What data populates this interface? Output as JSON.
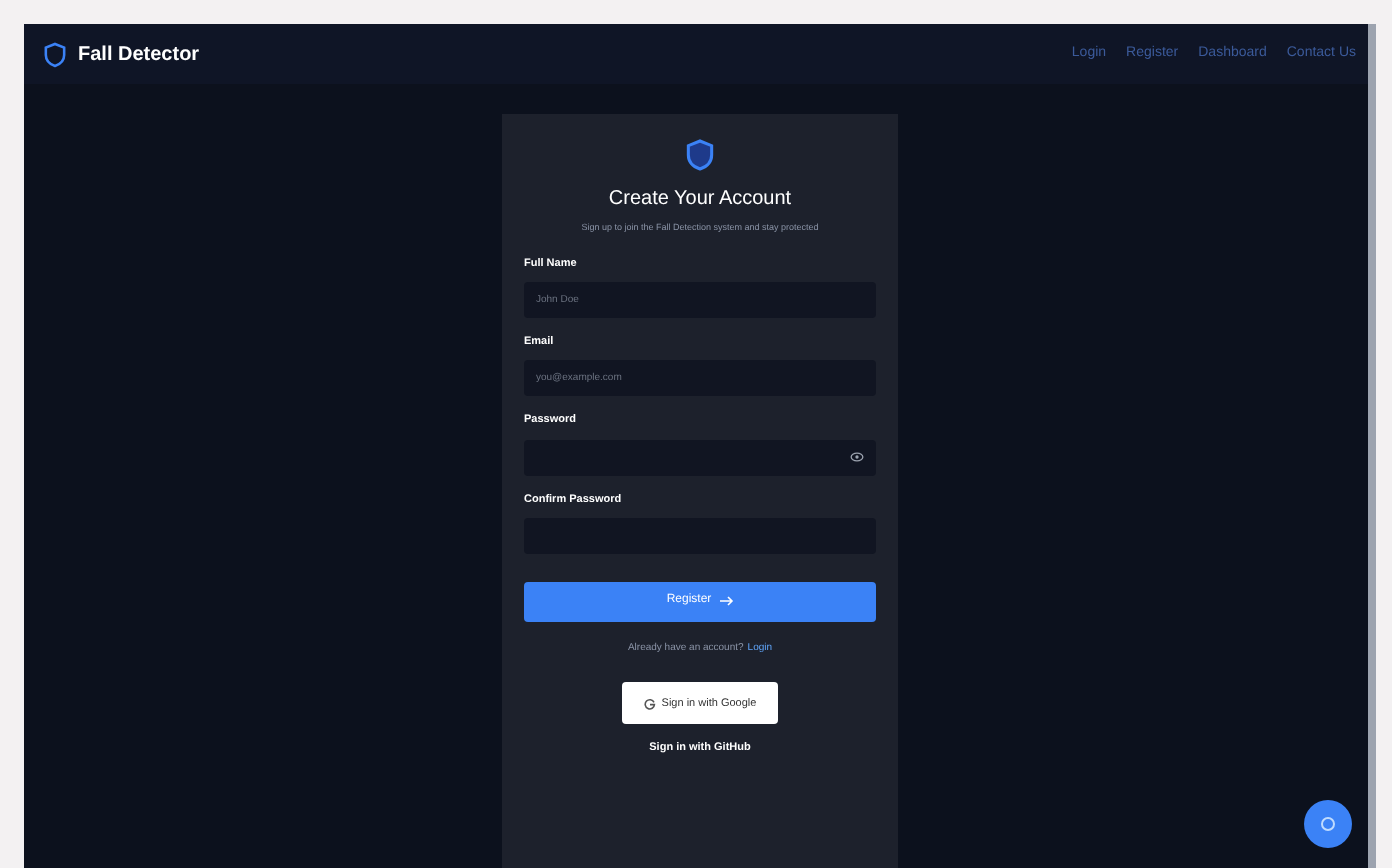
{
  "navbar": {
    "brand": "Fall Detector",
    "links": [
      {
        "label": "Login"
      },
      {
        "label": "Register"
      },
      {
        "label": "Dashboard"
      },
      {
        "label": "Contact Us"
      }
    ]
  },
  "card": {
    "title": "Create Your Account",
    "subtitle": "Sign up to join the Fall Detection system and stay protected",
    "fields": [
      {
        "label": "Full Name",
        "placeholder": "John Doe",
        "kind": "text"
      },
      {
        "label": "Email",
        "placeholder": "you@example.com",
        "kind": "text"
      },
      {
        "label": "Password",
        "kind": "password"
      },
      {
        "label": "Confirm Password",
        "kind": "text"
      }
    ],
    "submit": "Register",
    "login_prompt": "Already have an account?",
    "login_link": "Login",
    "google_button": "Sign in with Google",
    "github_link": "Sign in with GitHub"
  }
}
